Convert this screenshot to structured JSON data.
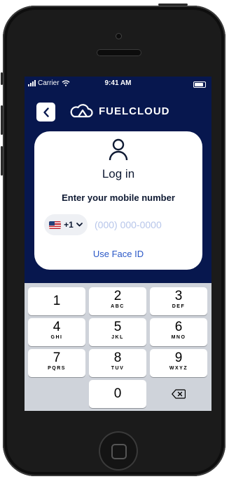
{
  "status_bar": {
    "carrier": "Carrier",
    "time": "9:41 AM"
  },
  "header": {
    "back_icon": "chevron-left-icon",
    "brand_icon": "cloud-icon",
    "brand_name": "FUELCLOUD"
  },
  "login": {
    "icon": "user-icon",
    "title": "Log in",
    "subtitle": "Enter your mobile number",
    "country_code": "+1",
    "country_flag": "us-flag-icon",
    "phone_placeholder": "(000) 000-0000",
    "phone_value": "",
    "face_id_label": "Use Face ID"
  },
  "keypad": {
    "keys": [
      {
        "num": "1",
        "letters": ""
      },
      {
        "num": "2",
        "letters": "ABC"
      },
      {
        "num": "3",
        "letters": "DEF"
      },
      {
        "num": "4",
        "letters": "GHI"
      },
      {
        "num": "5",
        "letters": "JKL"
      },
      {
        "num": "6",
        "letters": "MNO"
      },
      {
        "num": "7",
        "letters": "PQRS"
      },
      {
        "num": "8",
        "letters": "TUV"
      },
      {
        "num": "9",
        "letters": "WXYZ"
      },
      {
        "num": "0",
        "letters": ""
      }
    ],
    "delete_icon": "backspace-icon"
  },
  "colors": {
    "screen_background": "#07174e",
    "accent_link": "#2b58c7",
    "placeholder": "#b7c6ea",
    "keypad_background": "#cfd3da"
  }
}
